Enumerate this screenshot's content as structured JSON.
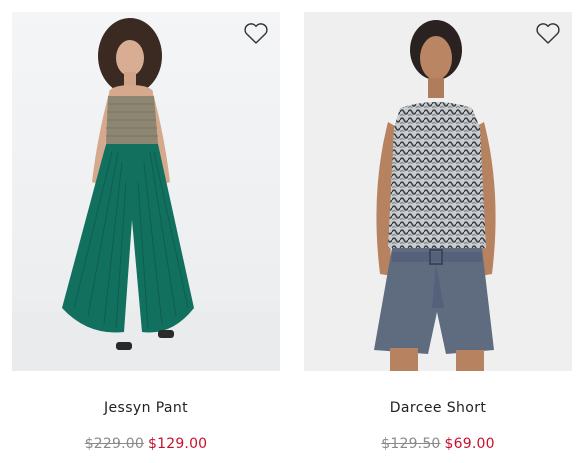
{
  "products": [
    {
      "name": "Jessyn Pant",
      "original_price": "$229.00",
      "sale_price": "$129.00",
      "wishlist_icon": "heart-outline-icon"
    },
    {
      "name": "Darcee Short",
      "original_price": "$129.50",
      "sale_price": "$69.00",
      "wishlist_icon": "heart-outline-icon"
    }
  ],
  "colors": {
    "sale_price": "#c8102e",
    "original_price": "#8a8a8a",
    "name_text": "#222222"
  }
}
